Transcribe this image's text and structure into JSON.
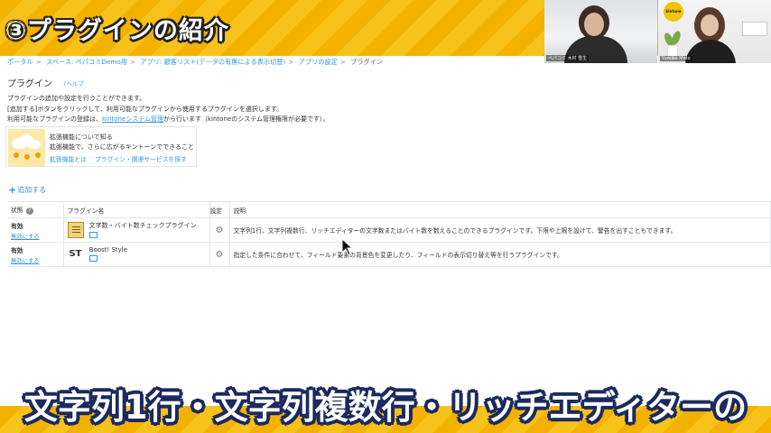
{
  "top_banner": {
    "title": "③プラグインの紹介"
  },
  "video_tiles": [
    {
      "name": "ペパコミ 木村 雪生"
    },
    {
      "name": "Yumiko Moto"
    }
  ],
  "breadcrumb": [
    "ポータル",
    "スペース: ペパコミDemo用",
    "アプリ: 顧客リスト(データの有無による表示切替)",
    "アプリの設定",
    "プラグイン"
  ],
  "page": {
    "title": "プラグイン",
    "help": "?ヘルプ",
    "desc1": "プラグインの追加や設定を行うことができます。",
    "desc2": "[追加する]ボタンをクリックして、利用可能なプラグインから使用するプラグインを選択します。",
    "desc3_prefix": "利用可能なプラグインの登録は、",
    "desc3_link": "kintoneシステム管理",
    "desc3_suffix": "から行います（kintoneのシステム管理権限が必要です）。"
  },
  "extension": {
    "title": "拡張機能について知る",
    "sub": "拡張機能で、さらに広がるキントーンでできること",
    "link1": "拡張機能とは",
    "link2": "プラグイン・関連サービスを探す"
  },
  "add_button": "追加する",
  "table": {
    "headers": {
      "state": "状態",
      "name": "プラグイン名",
      "settings": "設定",
      "desc": "説明"
    },
    "rows": [
      {
        "state": "有効",
        "disable": "無効にする",
        "name": "文字数・バイト数チェックプラグイン",
        "icon": "document-icon",
        "desc": "文字列1行、文字列複数行、リッチエディターの文字数またはバイト数を数えることのできるプラグインです。下限や上限を設けて、警告を出すこともできます。"
      },
      {
        "state": "有効",
        "disable": "無効にする",
        "name": "Boost! Style",
        "icon": "st-logo-icon",
        "desc": "指定した条件に合わせて、フィールド要素の背景色を変更したり、フィールドの表示切り替え等を行うプラグインです。"
      }
    ]
  },
  "subtitle": "文字列1行・文字列複数行・リッチエディターの",
  "colors": {
    "link": "#3498db",
    "banner": "#f3b200",
    "subtitle_outline": "#1b2a5e"
  }
}
